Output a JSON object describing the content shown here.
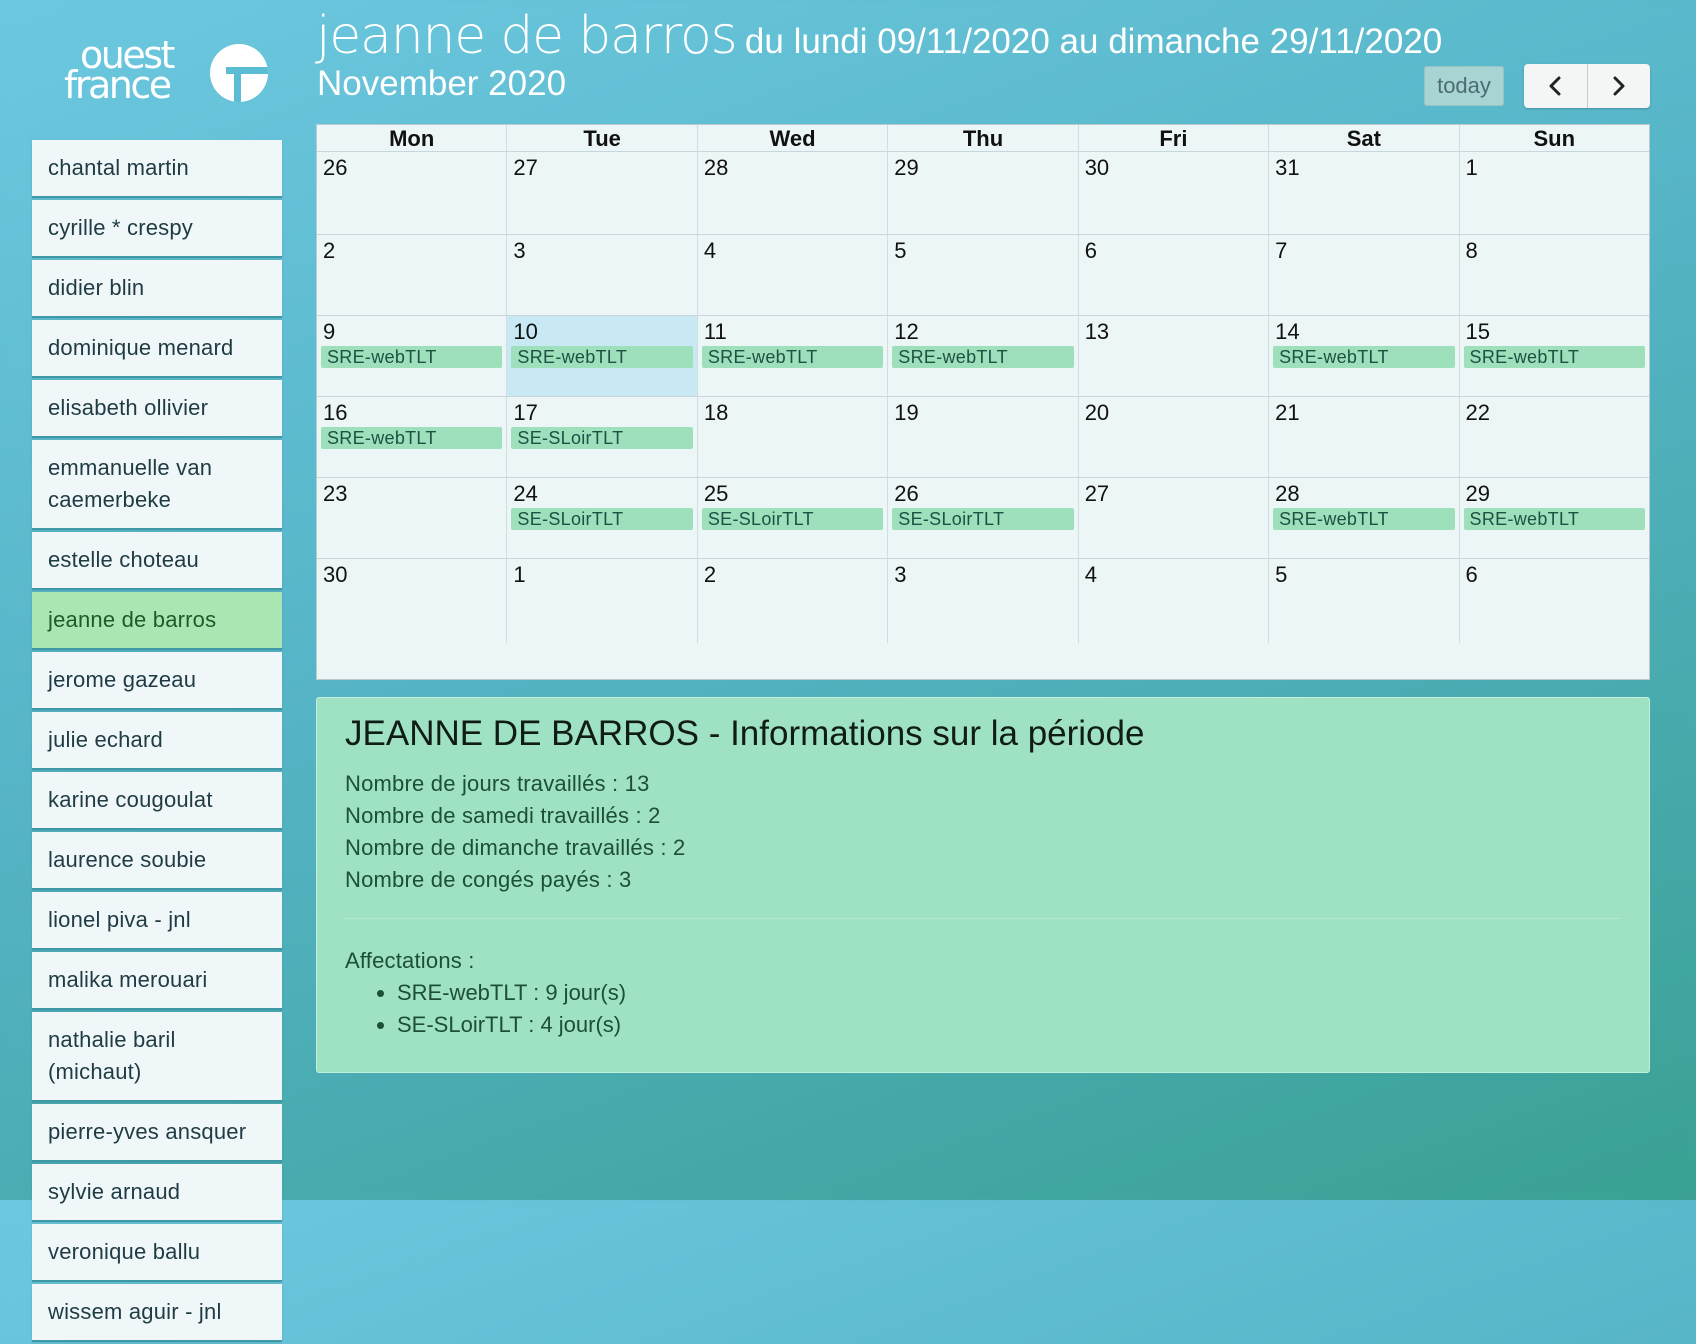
{
  "logo": {
    "line1": "ouest",
    "line2": "france"
  },
  "sidebar": {
    "items": [
      {
        "label": "chantal martin"
      },
      {
        "label": "cyrille * crespy"
      },
      {
        "label": "didier blin"
      },
      {
        "label": "dominique menard"
      },
      {
        "label": "elisabeth ollivier"
      },
      {
        "label": "emmanuelle van caemerbeke"
      },
      {
        "label": "estelle choteau"
      },
      {
        "label": "jeanne de barros",
        "active": true
      },
      {
        "label": "jerome gazeau"
      },
      {
        "label": "julie echard"
      },
      {
        "label": "karine cougoulat"
      },
      {
        "label": "laurence soubie"
      },
      {
        "label": "lionel piva - jnl"
      },
      {
        "label": "malika merouari"
      },
      {
        "label": "nathalie baril (michaut)"
      },
      {
        "label": "pierre-yves ansquer"
      },
      {
        "label": "sylvie arnaud"
      },
      {
        "label": "veronique ballu"
      },
      {
        "label": "wissem aguir - jnl"
      }
    ]
  },
  "header": {
    "name": "jeanne de barros",
    "range": "du lundi 09/11/2020 au dimanche 29/11/2020",
    "month": "November 2020",
    "today_label": "today",
    "prev_icon": "chevron-left-icon",
    "next_icon": "chevron-right-icon"
  },
  "calendar": {
    "weekdays": [
      "Mon",
      "Tue",
      "Wed",
      "Thu",
      "Fri",
      "Sat",
      "Sun"
    ],
    "weeks": [
      [
        {
          "d": "26"
        },
        {
          "d": "27"
        },
        {
          "d": "28"
        },
        {
          "d": "29"
        },
        {
          "d": "30"
        },
        {
          "d": "31"
        },
        {
          "d": "1"
        }
      ],
      [
        {
          "d": "2"
        },
        {
          "d": "3"
        },
        {
          "d": "4"
        },
        {
          "d": "5"
        },
        {
          "d": "6"
        },
        {
          "d": "7"
        },
        {
          "d": "8"
        }
      ],
      [
        {
          "d": "9",
          "e": "SRE-webTLT"
        },
        {
          "d": "10",
          "e": "SRE-webTLT",
          "today": true
        },
        {
          "d": "11",
          "e": "SRE-webTLT"
        },
        {
          "d": "12",
          "e": "SRE-webTLT"
        },
        {
          "d": "13"
        },
        {
          "d": "14",
          "e": "SRE-webTLT"
        },
        {
          "d": "15",
          "e": "SRE-webTLT"
        }
      ],
      [
        {
          "d": "16",
          "e": "SRE-webTLT"
        },
        {
          "d": "17",
          "e": "SE-SLoirTLT"
        },
        {
          "d": "18"
        },
        {
          "d": "19"
        },
        {
          "d": "20"
        },
        {
          "d": "21"
        },
        {
          "d": "22"
        }
      ],
      [
        {
          "d": "23"
        },
        {
          "d": "24",
          "e": "SE-SLoirTLT"
        },
        {
          "d": "25",
          "e": "SE-SLoirTLT"
        },
        {
          "d": "26",
          "e": "SE-SLoirTLT"
        },
        {
          "d": "27"
        },
        {
          "d": "28",
          "e": "SRE-webTLT"
        },
        {
          "d": "29",
          "e": "SRE-webTLT"
        }
      ],
      [
        {
          "d": "30"
        },
        {
          "d": "1"
        },
        {
          "d": "2"
        },
        {
          "d": "3"
        },
        {
          "d": "4"
        },
        {
          "d": "5"
        },
        {
          "d": "6"
        }
      ]
    ]
  },
  "info": {
    "title": "JEANNE DE BARROS - Informations sur la période",
    "stats": [
      "Nombre de jours travaillés : 13",
      "Nombre de samedi travaillés : 2",
      "Nombre de dimanche travaillés : 2",
      "Nombre de congés payés : 3"
    ],
    "affectations_label": "Affectations :",
    "affectations": [
      "SRE-webTLT : 9 jour(s)",
      "SE-SLoirTLT : 4 jour(s)"
    ]
  },
  "colors": {
    "active_item": "#a9e6b2",
    "event": "#9edfbc",
    "today_cell": "#c8e9f4",
    "info_panel": "#9fe2c3"
  }
}
